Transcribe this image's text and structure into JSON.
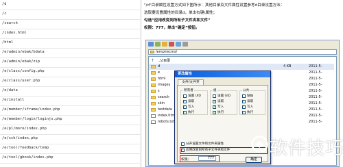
{
  "left_panel": {
    "paths": [
      "/d",
      "/c",
      "/search",
      "/index.html",
      "/html",
      "/e/admin/ebak/bdata",
      "/e/admin/ebak/zip",
      "/e/class/config.php",
      "/e/class/user.php",
      "/e/data",
      "/e/install",
      "/e/member/iframe/index.php",
      "/e/member/login/loginjs.php",
      "/e/pl/more/index.php",
      "/e/sch/index.php",
      "/e/tool/feedback/temp",
      "/e/tool/gbook/index.php"
    ]
  },
  "instructions": {
    "line1": "\"/d\"目录属性设置方式如下图所示：其他目录及文件属性设置参考d目录设置方法：",
    "line2": "选取要设置属性的目录d，单击右键\\属性；",
    "line3": "勾选“应用改变到所有子文件夹和文件”",
    "line4": "权限：777，单击“确定”按钮。"
  },
  "ftp": {
    "address": "/empirecms/",
    "files": [
      {
        "name": "..父目录",
        "type": "up",
        "size": "",
        "date": ""
      },
      {
        "name": "d",
        "type": "folder",
        "size": "4 KB",
        "date": "2011-5-"
      },
      {
        "name": "e",
        "type": "folder",
        "size": "",
        "date": "2011-5-"
      },
      {
        "name": "html",
        "type": "folder",
        "size": "",
        "date": "2011-5-"
      },
      {
        "name": "images",
        "type": "folder",
        "size": "",
        "date": "2011-5-"
      },
      {
        "name": "s",
        "type": "folder",
        "size": "",
        "date": "2011-5-"
      },
      {
        "name": "search",
        "type": "folder",
        "size": "",
        "date": "2011-5-"
      },
      {
        "name": "skin",
        "type": "folder",
        "size": "",
        "date": "2011-5-"
      },
      {
        "name": "testdata",
        "type": "folder",
        "size": "",
        "date": "2011-5-"
      },
      {
        "name": "index.html",
        "type": "doc",
        "size": "",
        "date": "2011-5-"
      },
      {
        "name": "robots.txt",
        "type": "doc",
        "size": "",
        "date": "2011-5-"
      }
    ]
  },
  "dialog": {
    "title": "更改属性",
    "tab": "文件/文件夹",
    "groups": {
      "owner": {
        "label": "所有者",
        "setid": "设置 UID",
        "read": "读取",
        "write": "写入",
        "exec": "执行"
      },
      "group": {
        "label": "组",
        "setid": "设置 GID",
        "read": "读取",
        "write": "写入",
        "exec": "执行"
      },
      "public": {
        "label": "公共",
        "setid": "粘贴",
        "read": "读取",
        "write": "写入",
        "exec": "执行"
      }
    },
    "option1": "分开设置文件和文件夹属性",
    "option2": "应用改变到所有子文件夹和文件",
    "perm_label": "权限：",
    "perm_value": "777",
    "ok": "确定"
  },
  "watermark": {
    "text": "软件技巧"
  },
  "colors": {
    "highlight": "#e00000",
    "dialog_title": "#0a5ee0",
    "folder": "#f2cd5c"
  }
}
